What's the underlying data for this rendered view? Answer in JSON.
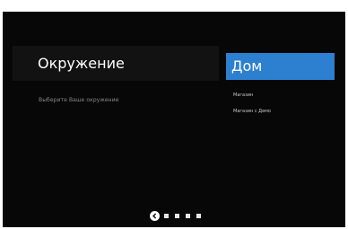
{
  "screen": {
    "title": "Окружение",
    "subtitle": "Выберите Ваше окружение",
    "options": {
      "selected": "Дом",
      "items": [
        "Магазин",
        "Магазин с Демо"
      ]
    },
    "pager": {
      "back_icon": "chevron-left-icon",
      "page_count": 5,
      "current_page": 1
    }
  },
  "colors": {
    "background": "#070707",
    "accent": "#2d7fd0",
    "title_box": "#121212"
  }
}
